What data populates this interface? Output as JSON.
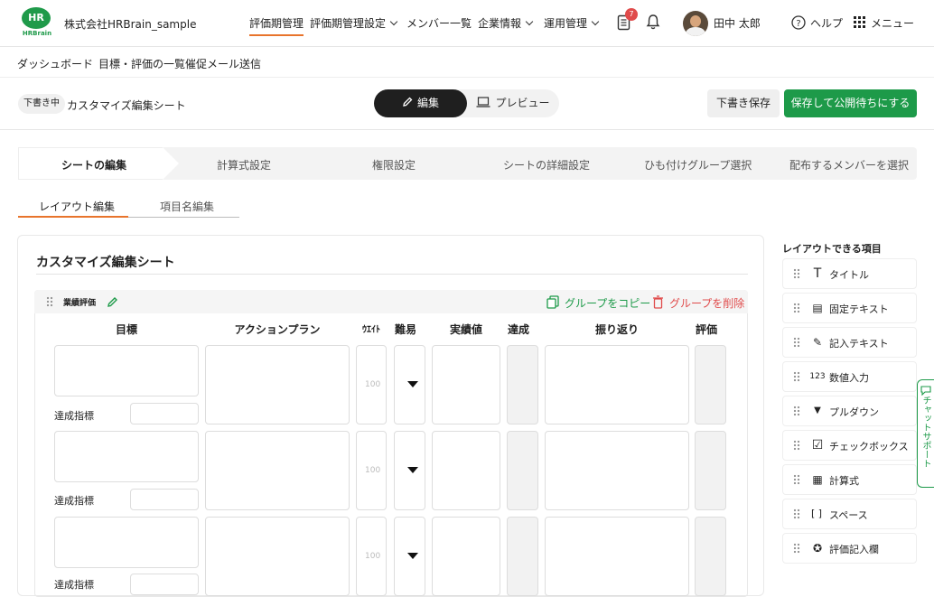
{
  "header": {
    "company": "株式会社HRBrain_sample",
    "logo": {
      "mark": "HR",
      "text": "HRBrain"
    },
    "nav": [
      {
        "label": "評価期管理"
      },
      {
        "label": "評価期管理設定"
      },
      {
        "label": "メンバー一覧"
      },
      {
        "label": "企業情報"
      },
      {
        "label": "運用管理"
      }
    ],
    "notification_count": "7",
    "user": "田中 太郎",
    "help": "ヘルプ",
    "menu": "メニュー"
  },
  "subnav": [
    "ダッシュボード",
    "目標・評価の一覧",
    "催促メール送信"
  ],
  "toolbar": {
    "status": "下書き中",
    "sheet_name": "カスタマイズ編集シート",
    "edit": "編集",
    "preview": "プレビュー",
    "save_draft": "下書き保存",
    "publish": "保存して公開待ちにする"
  },
  "steps": [
    "シートの編集",
    "計算式設定",
    "権限設定",
    "シートの詳細設定",
    "ひも付けグループ選択",
    "配布するメンバーを選択"
  ],
  "tabs": [
    "レイアウト編集",
    "項目名編集"
  ],
  "sheet": {
    "title": "カスタマイズ編集シート",
    "group_name": "業績評価",
    "copy_group": "グループをコピー",
    "delete_group": "グループを削除",
    "columns": [
      "目標",
      "アクションプラン",
      "ｳｴｲﾄ",
      "難易",
      "実績値",
      "達成",
      "振り返り",
      "評価"
    ],
    "row_label": "達成指標",
    "weight_placeholder": "100"
  },
  "sidebar": {
    "title": "レイアウトできる項目",
    "items": [
      {
        "icon": "T",
        "label": "タイトル"
      },
      {
        "icon": "▤",
        "label": "固定テキスト"
      },
      {
        "icon": "✎",
        "label": "記入テキスト"
      },
      {
        "icon": "123",
        "label": "数値入力"
      },
      {
        "icon": "▼",
        "label": "プルダウン"
      },
      {
        "icon": "☑",
        "label": "チェックボックス"
      },
      {
        "icon": "▦",
        "label": "計算式"
      },
      {
        "icon": "[ ]",
        "label": "スペース"
      },
      {
        "icon": "✪",
        "label": "評価記入欄"
      }
    ]
  },
  "chat": "チャットサポート",
  "colors": {
    "accent": "#e8742c",
    "primary": "#1d9a49",
    "danger": "#e04b4b"
  }
}
